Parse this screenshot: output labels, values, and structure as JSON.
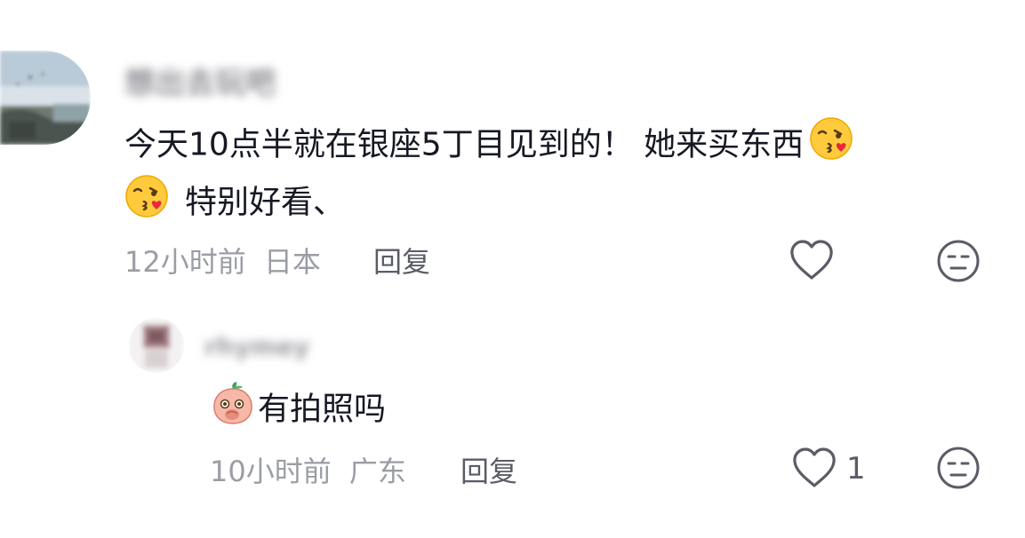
{
  "comment": {
    "username": "想出去玩吧",
    "text_line1": "今天10点半就在银座5丁目见到的！ 她来买东西",
    "text_line2": "特别好看、",
    "time": "12小时前",
    "location": "日本",
    "reply_label": "回复"
  },
  "reply": {
    "username": "rhymey",
    "text": "有拍照吗",
    "time": "10小时前",
    "location": "广东",
    "reply_label": "回复",
    "like_count": "1"
  },
  "icons": {
    "like": "heart-outline-icon",
    "dislike": "meh-face-icon",
    "emoji_kiss": "kiss-face-emoji",
    "emoji_peach": "peach-emoji"
  }
}
